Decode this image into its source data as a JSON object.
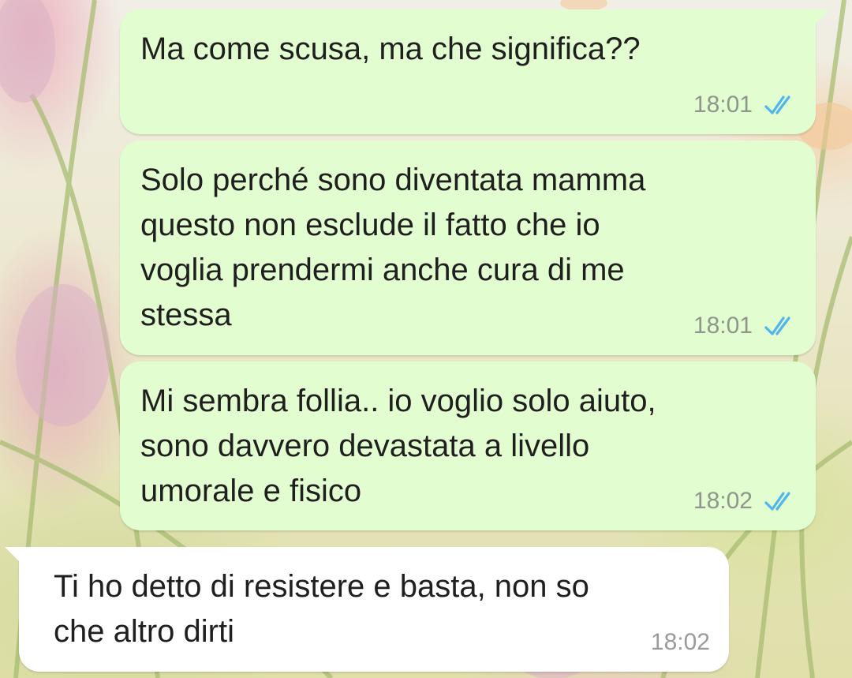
{
  "colors": {
    "outgoing_bubble": "#e2fdcf",
    "incoming_bubble": "#ffffff",
    "read_ticks": "#4fb6ec",
    "timestamp": "#8f968c"
  },
  "messages": [
    {
      "direction": "outgoing",
      "text": "Ma come scusa, ma che significa??",
      "time": "18:01",
      "status_icon": "double-check-read-icon"
    },
    {
      "direction": "outgoing",
      "text": "Solo perché sono diventata mamma\nquesto non esclude il fatto che io\nvoglia prendermi anche cura di me\nstessa",
      "time": "18:01",
      "status_icon": "double-check-read-icon"
    },
    {
      "direction": "outgoing",
      "text": "Mi sembra follia.. io voglio solo aiuto,\nsono davvero devastata a livello\numorale e fisico",
      "time": "18:02",
      "status_icon": "double-check-read-icon"
    },
    {
      "direction": "incoming",
      "text": "Ti ho detto di resistere e basta, non so\nche altro dirti",
      "time": "18:02"
    }
  ]
}
